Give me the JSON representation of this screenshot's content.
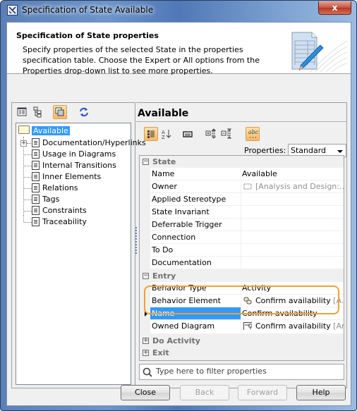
{
  "window": {
    "title": "Specification of State Available",
    "close_glyph": "x"
  },
  "header": {
    "title": "Specification of State properties",
    "description": "Specify properties of the selected State in the properties specification table. Choose the Expert or All options from the Properties drop-down list to see more properties."
  },
  "left_toolbar": {
    "icons": [
      "table-view-icon",
      "tree-view-icon",
      "compartment-view-icon",
      "refresh-icon"
    ]
  },
  "tree": {
    "root": "Available",
    "items": [
      {
        "label": "Documentation/Hyperlinks",
        "expandable": true
      },
      {
        "label": "Usage in Diagrams"
      },
      {
        "label": "Internal Transitions"
      },
      {
        "label": "Inner Elements"
      },
      {
        "label": "Relations"
      },
      {
        "label": "Tags"
      },
      {
        "label": "Constraints"
      },
      {
        "label": "Traceability"
      }
    ]
  },
  "right": {
    "title": "Available",
    "properties_label": "Properties:",
    "properties_value": "Standard",
    "toolbar_icons": [
      "categorized-icon",
      "sort-alphabetically-icon",
      "show-description-icon",
      "expand-all-icon",
      "collapse-all-icon",
      "show-abc-icon"
    ]
  },
  "grid": {
    "groups": [
      {
        "label": "State",
        "expanded": true,
        "rows": [
          {
            "key": "Name",
            "value": "Available"
          },
          {
            "key": "Owner",
            "value": "[Analysis and Design:...",
            "muted": true,
            "icon": "region-icon"
          },
          {
            "key": "Applied Stereotype",
            "value": ""
          },
          {
            "key": "State Invariant",
            "value": ""
          },
          {
            "key": "Deferrable Trigger",
            "value": ""
          },
          {
            "key": "Connection",
            "value": ""
          },
          {
            "key": "To Do",
            "value": ""
          },
          {
            "key": "Documentation",
            "value": ""
          }
        ]
      },
      {
        "label": "Entry",
        "expanded": true,
        "rows": [
          {
            "key": "Behavior Type",
            "value": "Activity"
          },
          {
            "key": "Behavior Element",
            "value": "Confirm availability",
            "suffix": "[A...",
            "icon": "activity-icon"
          },
          {
            "key": "Name",
            "value": "Confirm availability",
            "selected": true
          },
          {
            "key": "Owned Diagram",
            "value": "Confirm availability",
            "suffix": "[Analy",
            "icon": "diagram-icon"
          }
        ]
      },
      {
        "label": "Do Activity",
        "expanded": false
      },
      {
        "label": "Exit",
        "expanded": false
      }
    ]
  },
  "filter": {
    "placeholder": "Type here to filter properties"
  },
  "buttons": {
    "close": "Close",
    "back": "Back",
    "forward": "Forward",
    "help": "Help"
  }
}
